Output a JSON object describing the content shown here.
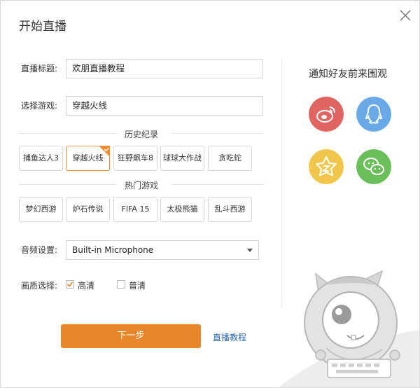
{
  "dialog": {
    "title": "开始直播",
    "close_label": "×"
  },
  "form": {
    "title_label": "直播标题:",
    "title_value": "欢朋直播教程",
    "game_label": "选择游戏:",
    "game_value": "穿越火线",
    "history_heading": "历史纪录",
    "history_games": [
      "捕鱼达人3",
      "穿越火线",
      "狂野飙车8",
      "球球大作战",
      "贪吃蛇"
    ],
    "history_selected_index": 1,
    "hot_heading": "热门游戏",
    "hot_games": [
      "梦幻西游",
      "炉石传说",
      "FIFA 15",
      "太极熊猫",
      "乱斗西游"
    ],
    "audio_label": "音频设置:",
    "audio_value": "Built-in Microphone",
    "quality_label": "画质选择:",
    "quality_high": "高清",
    "quality_normal": "普清",
    "quality_high_checked": true,
    "quality_normal_checked": false
  },
  "actions": {
    "next_label": "下一步",
    "tutorial_link": "直播教程"
  },
  "share": {
    "heading": "通知好友前来围观",
    "services": [
      "weibo-icon",
      "qq-icon",
      "qzone-icon",
      "wechat-icon"
    ]
  },
  "colors": {
    "accent_orange": "#e8852a",
    "selected_border": "#f08c2c",
    "link_blue": "#2a66b0",
    "weibo": "#e0645f",
    "qq": "#6aa9e8",
    "qzone": "#f0c74a",
    "wechat": "#6bbf5a"
  }
}
